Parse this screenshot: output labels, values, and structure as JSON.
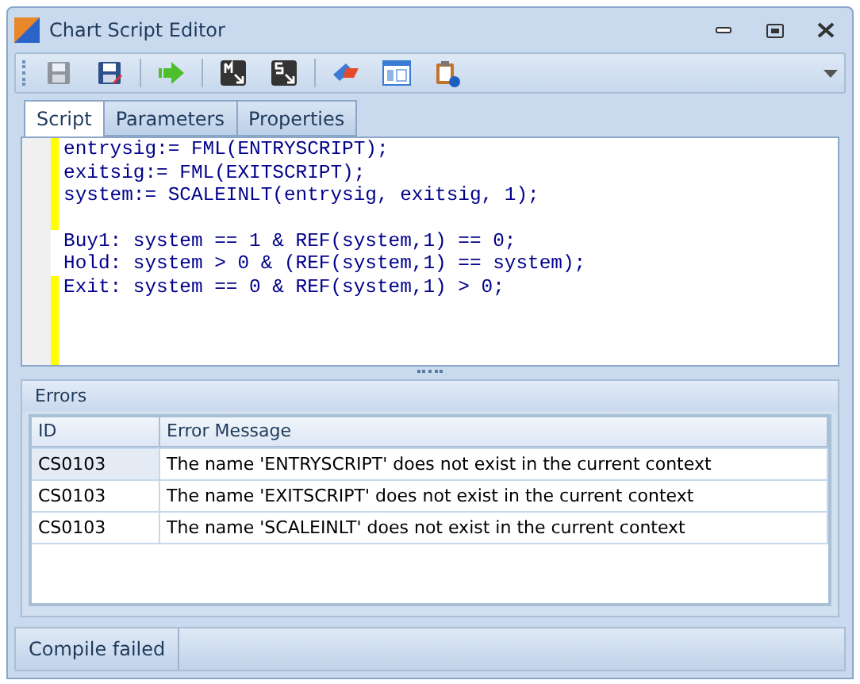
{
  "window": {
    "title": "Chart Script Editor"
  },
  "toolbar_groups": [
    [
      {
        "kind": "save",
        "disabled": true
      },
      {
        "kind": "save-as",
        "disabled": false
      }
    ],
    [
      {
        "kind": "run",
        "disabled": false
      }
    ],
    [
      {
        "kind": "m-arrow",
        "disabled": false
      },
      {
        "kind": "s-arrow",
        "disabled": false
      }
    ],
    [
      {
        "kind": "eraser",
        "disabled": false
      },
      {
        "kind": "layout",
        "disabled": false
      },
      {
        "kind": "clipboard",
        "disabled": false
      }
    ]
  ],
  "tabs": [
    {
      "label": "Script",
      "selected": true
    },
    {
      "label": "Parameters",
      "selected": false
    },
    {
      "label": "Properties",
      "selected": false
    }
  ],
  "editor": {
    "lines": [
      {
        "text": "entrysig:= FML(ENTRYSCRIPT);",
        "modified": true
      },
      {
        "text": "exitsig:= FML(EXITSCRIPT);",
        "modified": true
      },
      {
        "text": "system:= SCALEINLT(entrysig, exitsig, 1);",
        "modified": true
      },
      {
        "modified": true
      },
      {
        "text": "Buy1: system == 1 & REF(system,1) == 0;",
        "modified": false
      },
      {
        "text": "Hold: system > 0 & (REF(system,1) == system);",
        "modified": false
      },
      {
        "text": "Exit: system == 0 & REF(system,1) > 0;",
        "modified": true
      },
      {
        "modified": true
      },
      {
        "modified": true
      },
      {
        "modified": true
      }
    ]
  },
  "errors": {
    "title": "Errors",
    "columns": [
      "ID",
      "Error Message"
    ],
    "rows": [
      {
        "id": "CS0103",
        "message": "The name 'ENTRYSCRIPT' does not exist in the current context",
        "selected": true
      },
      {
        "id": "CS0103",
        "message": "The name 'EXITSCRIPT' does not exist in the current context",
        "selected": false
      },
      {
        "id": "CS0103",
        "message": "The name 'SCALEINLT' does not exist in the current context",
        "selected": false
      }
    ]
  },
  "status_bar": "Compile failed"
}
